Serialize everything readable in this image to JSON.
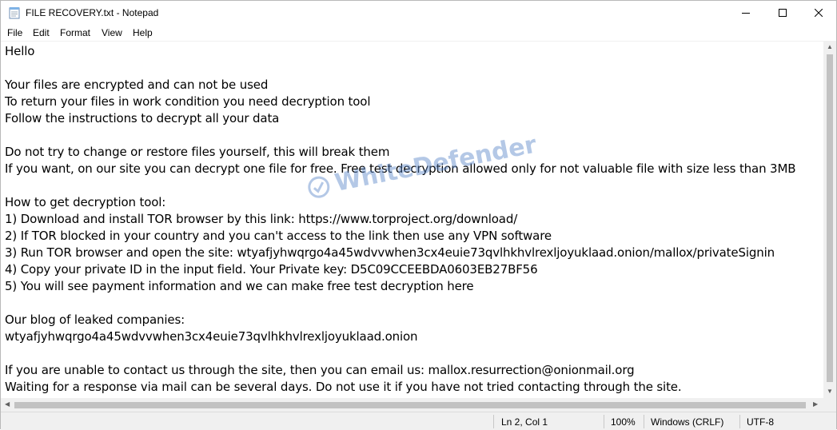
{
  "window": {
    "title": "FILE RECOVERY.txt - Notepad"
  },
  "menu": [
    "File",
    "Edit",
    "Format",
    "View",
    "Help"
  ],
  "document": {
    "lines": [
      "Hello",
      "",
      "Your files are encrypted and can not be used",
      "To return your files in work condition you need decryption tool",
      "Follow the instructions to decrypt all your data",
      "",
      "Do not try to change or restore files yourself, this will break them",
      "If you want, on our site you can decrypt one file for free. Free test decryption allowed only for not valuable file with size less than 3MB",
      "",
      "How to get decryption tool:",
      "1) Download and install TOR browser by this link: https://www.torproject.org/download/",
      "2) If TOR blocked in your country and you can't access to the link then use any VPN software",
      "3) Run TOR browser and open the site: wtyafjyhwqrgo4a45wdvvwhen3cx4euie73qvlhkhvlrexljoyuklaad.onion/mallox/privateSignin",
      "4) Copy your private ID in the input field. Your Private key: D5C09CCEEBDA0603EB27BF56",
      "5) You will see payment information and we can make free test decryption here",
      "",
      "Our blog of leaked companies:",
      "wtyafjyhwqrgo4a45wdvvwhen3cx4euie73qvlhkhvlrexljoyuklaad.onion",
      "",
      "If you are unable to contact us through the site, then you can email us: mallox.resurrection@onionmail.org",
      "Waiting for a response via mail can be several days. Do not use it if you have not tried contacting through the site."
    ]
  },
  "status": {
    "position": "Ln 2, Col 1",
    "zoom": "100%",
    "line_ending": "Windows (CRLF)",
    "encoding": "UTF-8"
  },
  "watermark": "WhiteDefender",
  "icons": {
    "app": "notepad-icon",
    "minimize": "minimize-icon",
    "maximize": "maximize-icon",
    "close": "close-icon"
  }
}
